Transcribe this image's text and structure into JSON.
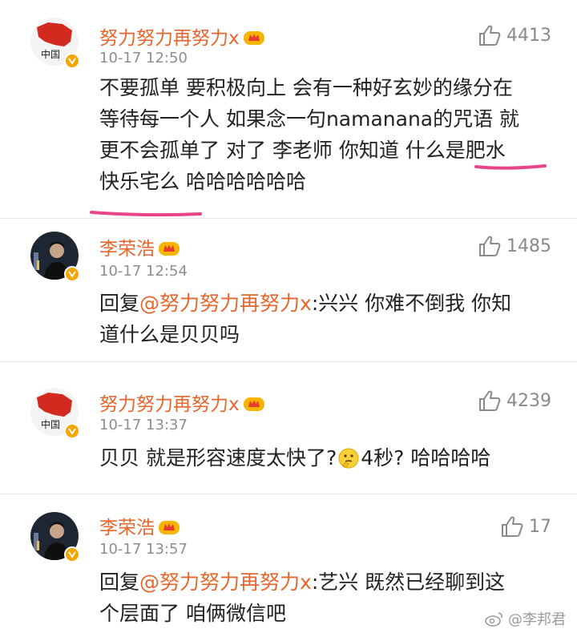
{
  "comments": [
    {
      "user": "努力努力再努力x",
      "avatar_text": "中国",
      "time": "10-17 12:50",
      "likes": "4413",
      "lines": [
        "不要孤单 要积极向上 会有一种好玄妙的缘分在",
        "等待每一个人 如果念一句namanana的咒语 就",
        "更不会孤单了  对了 李老师 你知道 什么是肥水",
        "快乐宅么 哈哈哈哈哈哈"
      ]
    },
    {
      "user": "李荣浩",
      "time": "10-17 12:54",
      "likes": "1485",
      "reply_prefix": "回复",
      "mention": "@努力努力再努力x",
      "line1_rest": ":兴兴 你难不倒我 你知",
      "line2": "道什么是贝贝吗"
    },
    {
      "user": "努力努力再努力x",
      "avatar_text": "中国",
      "time": "10-17 13:37",
      "likes": "4239",
      "text_before": "贝贝 就是形容速度太快了?",
      "text_after": "4秒?  哈哈哈哈"
    },
    {
      "user": "李荣浩",
      "time": "10-17 13:57",
      "likes": "17",
      "reply_prefix": "回复",
      "mention": "@努力努力再努力x",
      "line1_rest": ":艺兴 既然已经聊到这",
      "line2": "个层面了 咱俩微信吧"
    }
  ],
  "watermark": "@李邦君",
  "colors": {
    "username": "#e7662e",
    "highlight": "#e8448a",
    "verified": "#f5a400"
  },
  "icons": {
    "like": "thumb-up-icon",
    "crown": "vip-crown-icon",
    "verified": "verified-v-icon",
    "emoji": "thinking-face-icon",
    "watermark": "weibo-logo-icon"
  }
}
